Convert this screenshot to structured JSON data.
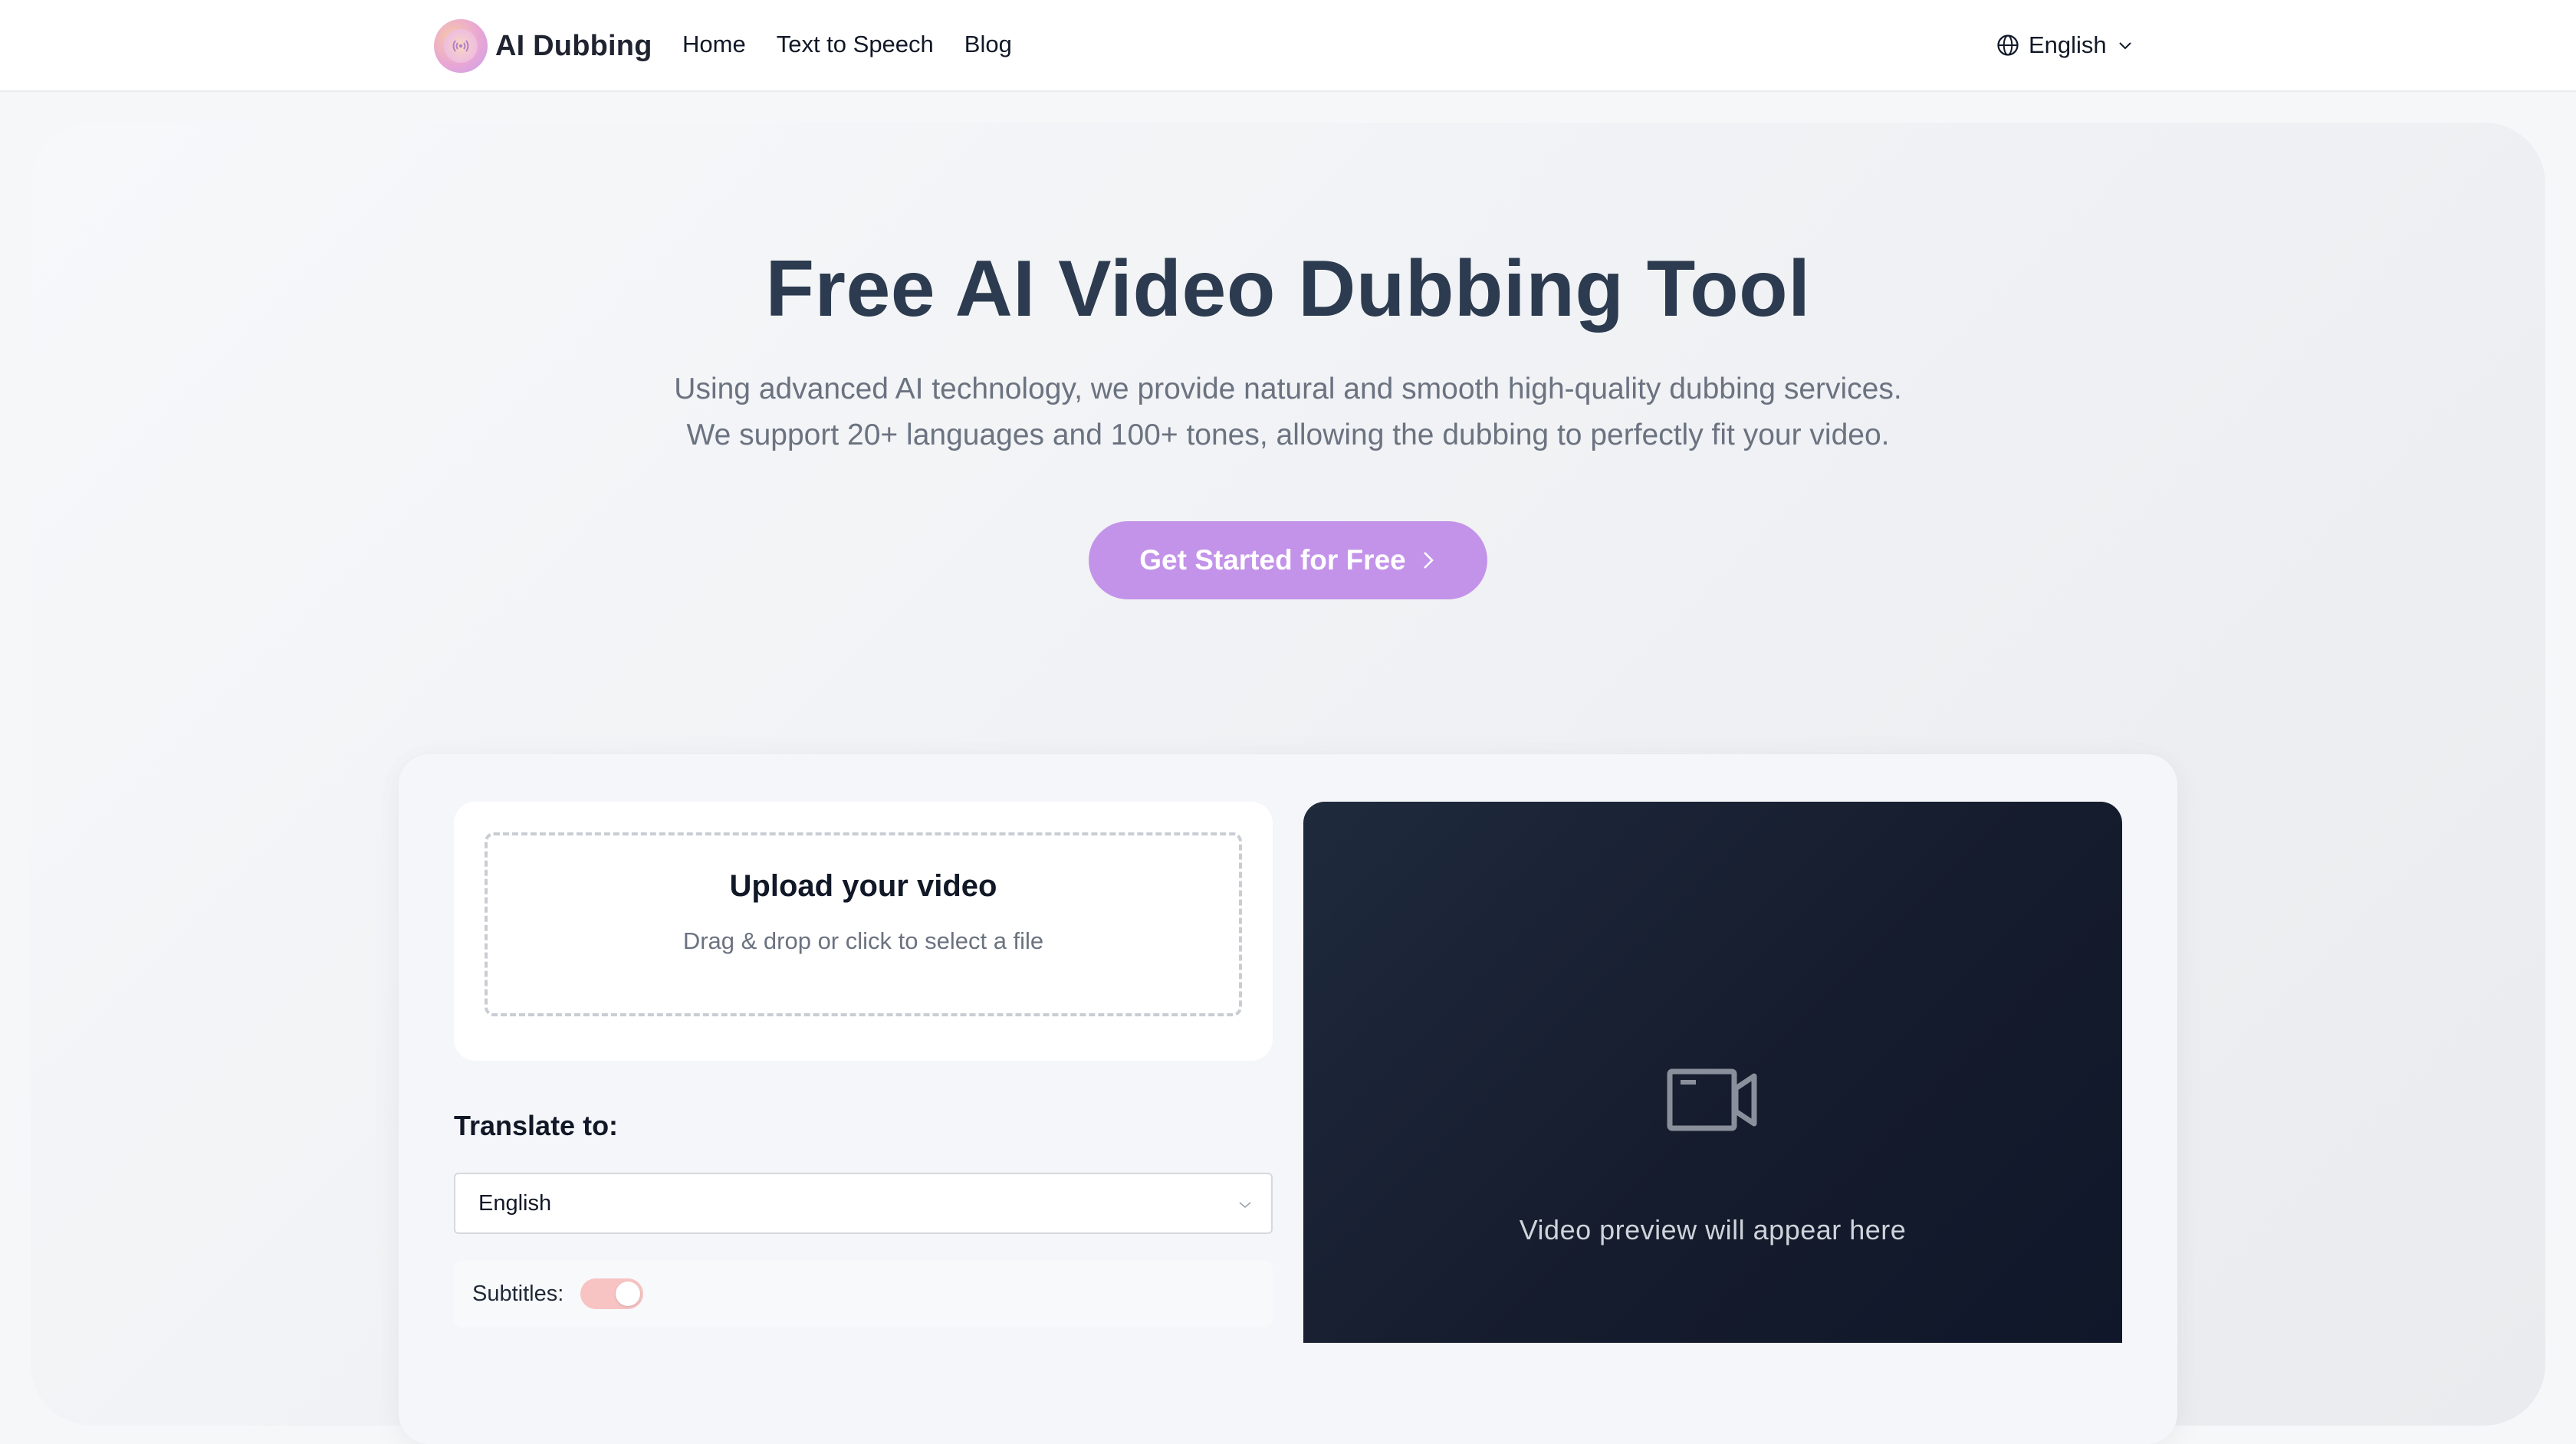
{
  "navbar": {
    "brand_name": "AI Dubbing",
    "links": [
      "Home",
      "Text to Speech",
      "Blog"
    ],
    "language": "English"
  },
  "hero": {
    "title": "Free AI Video Dubbing Tool",
    "subtitle_line1": "Using advanced AI technology, we provide natural and smooth high-quality dubbing services.",
    "subtitle_line2": "We support 20+ languages and 100+ tones, allowing the dubbing to perfectly fit your video.",
    "cta_label": "Get Started for Free"
  },
  "workspace": {
    "upload_title": "Upload your video",
    "upload_hint": "Drag & drop or click to select a file",
    "translate_label": "Translate to:",
    "translate_value": "English",
    "subtitles_label": "Subtitles:",
    "subtitles_on": true,
    "preview_text": "Video preview will appear here"
  },
  "colors": {
    "accent": "#c393ea",
    "title": "#2c3b4f",
    "preview_bg": "#151c2d",
    "toggle": "#f7c3c3"
  },
  "icons": {
    "logo": "sound-wave-icon",
    "language": "globe-icon",
    "dropdown": "chevron-down-icon",
    "cta": "chevron-right-icon",
    "preview": "video-camera-icon"
  }
}
